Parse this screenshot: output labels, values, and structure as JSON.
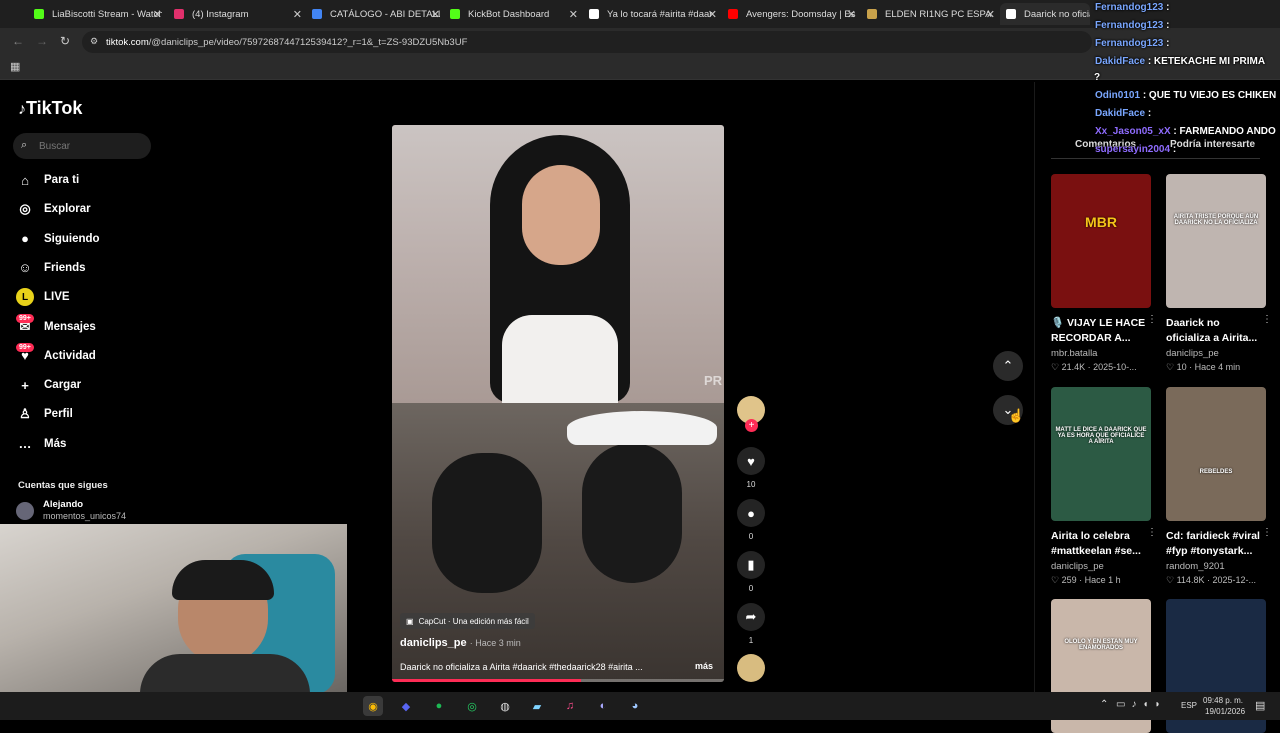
{
  "browser": {
    "tabs": [
      {
        "title": "LiaBiscotti Stream - Watch",
        "color": "#53fc18"
      },
      {
        "title": "(4) Instagram",
        "color": "#e1306c"
      },
      {
        "title": "CATÁLOGO - ABI DETALLE",
        "color": "#4285f4"
      },
      {
        "title": "KickBot Dashboard",
        "color": "#53fc18"
      },
      {
        "title": "Ya lo tocará #airita #daar",
        "color": "#ffffff"
      },
      {
        "title": "Avengers: Doomsday | Es",
        "color": "#ff0000"
      },
      {
        "title": "ELDEN RI1NG PC ESPA",
        "color": "#c9a24b"
      },
      {
        "title": "Daarick no oficializa",
        "color": "#ffffff"
      }
    ],
    "url_domain": "tiktok.com",
    "url_path": "/@daniclips_pe/video/7597268744712539412?_r=1&_t=ZS-93DZU5Nb3UF"
  },
  "tiktok": {
    "logo": "TikTok",
    "search_placeholder": "Buscar",
    "nav": [
      {
        "label": "Para ti",
        "icon": "home-icon",
        "glyph": "⌂"
      },
      {
        "label": "Explorar",
        "icon": "compass-icon",
        "glyph": "◎"
      },
      {
        "label": "Siguiendo",
        "icon": "following-icon",
        "glyph": "●"
      },
      {
        "label": "Friends",
        "icon": "friends-icon",
        "glyph": "☺"
      },
      {
        "label": "LIVE",
        "icon": "live-icon",
        "glyph": "L"
      },
      {
        "label": "Mensajes",
        "icon": "messages-icon",
        "glyph": "✉",
        "badge": "99+"
      },
      {
        "label": "Actividad",
        "icon": "activity-icon",
        "glyph": "♥",
        "badge": "99+"
      },
      {
        "label": "Cargar",
        "icon": "upload-icon",
        "glyph": "+"
      },
      {
        "label": "Perfil",
        "icon": "profile-icon",
        "glyph": "♙"
      },
      {
        "label": "Más",
        "icon": "more-icon",
        "glyph": "…"
      }
    ],
    "following_header": "Cuentas que sigues",
    "following": [
      {
        "name": "Alejando",
        "handle": "momentos_unicos74"
      }
    ],
    "video": {
      "badge": "CapCut · Una edición más fácil",
      "author": "daniclips_pe",
      "time": "Hace 3 min",
      "caption": "Daarick no oficializa a Airita #daarick #thedaarick28 #airita ...",
      "more": "más",
      "watermark": "PR",
      "progress": 0.57
    },
    "actions": {
      "likes": "10",
      "comments": "0",
      "saves": "0",
      "shares": "1"
    },
    "right_tabs": [
      "Comentarios",
      "Podría interesarte"
    ],
    "cards": [
      {
        "title": "🎙️ VIJAY LE HACE RECORDAR A...",
        "author": "mbr.batalla",
        "likes": "21.4K",
        "time": "2025-10-...",
        "thumb_label": "MBR",
        "bg": "#7a1010"
      },
      {
        "title": "Daarick no oficializa a Airita...",
        "author": "daniclips_pe",
        "likes": "10",
        "time": "Hace 4 min",
        "thumb_label": "AIRITA TRISTE PORQUE AÚN DAARICK NO LA OFICIALIZA",
        "bg": "#bfb5b0"
      },
      {
        "title": "Airita lo celebra #mattkeelan #se...",
        "author": "daniclips_pe",
        "likes": "259",
        "time": "Hace 1 h",
        "thumb_label": "MATT LE DICE A DAARICK QUE YA ES HORA QUE OFICIALICE A AIRITA",
        "bg": "#2c5a44"
      },
      {
        "title": "Cd: faridieck #viral #fyp #tonystark...",
        "author": "random_9201",
        "likes": "114.8K",
        "time": "2025-12-...",
        "thumb_label": "REBELDES",
        "bg": "#7a6a5a"
      },
      {
        "title": "",
        "author": "",
        "likes": "",
        "time": "",
        "thumb_label": "OLOLO Y EN ESTAN MUY ENAMORADOS",
        "bg": "#c9b7aa"
      },
      {
        "title": "",
        "author": "",
        "likes": "",
        "time": "",
        "thumb_label": "",
        "bg": "#1a2a44"
      }
    ]
  },
  "chat": [
    {
      "user": "Fernandog123",
      "msg": ":",
      "color": "#7aa7ff"
    },
    {
      "user": "Fernandog123",
      "msg": ":",
      "color": "#7aa7ff"
    },
    {
      "user": "Fernandog123",
      "msg": ":",
      "color": "#7aa7ff"
    },
    {
      "user": "DakidFace",
      "msg": ": KETEKACHE MI PRIMA",
      "color": "#7aa7ff"
    },
    {
      "user": "",
      "msg": "?",
      "color": "#fff"
    },
    {
      "user": "Odin0101",
      "msg": ": QUE TU VIEJO ES CHIKEN",
      "color": "#7aa7ff"
    },
    {
      "user": "DakidFace",
      "msg": ":",
      "color": "#7aa7ff"
    },
    {
      "user": "Xx_Jason05_xX",
      "msg": ": FARMEANDO ANDO",
      "color": "#8f6cff"
    },
    {
      "user": "supersayin2004",
      "msg": ":",
      "color": "#8f6cff"
    }
  ],
  "taskbar": {
    "lang": "ESP",
    "time": "09:48 p. m.",
    "date": "19/01/2026"
  }
}
